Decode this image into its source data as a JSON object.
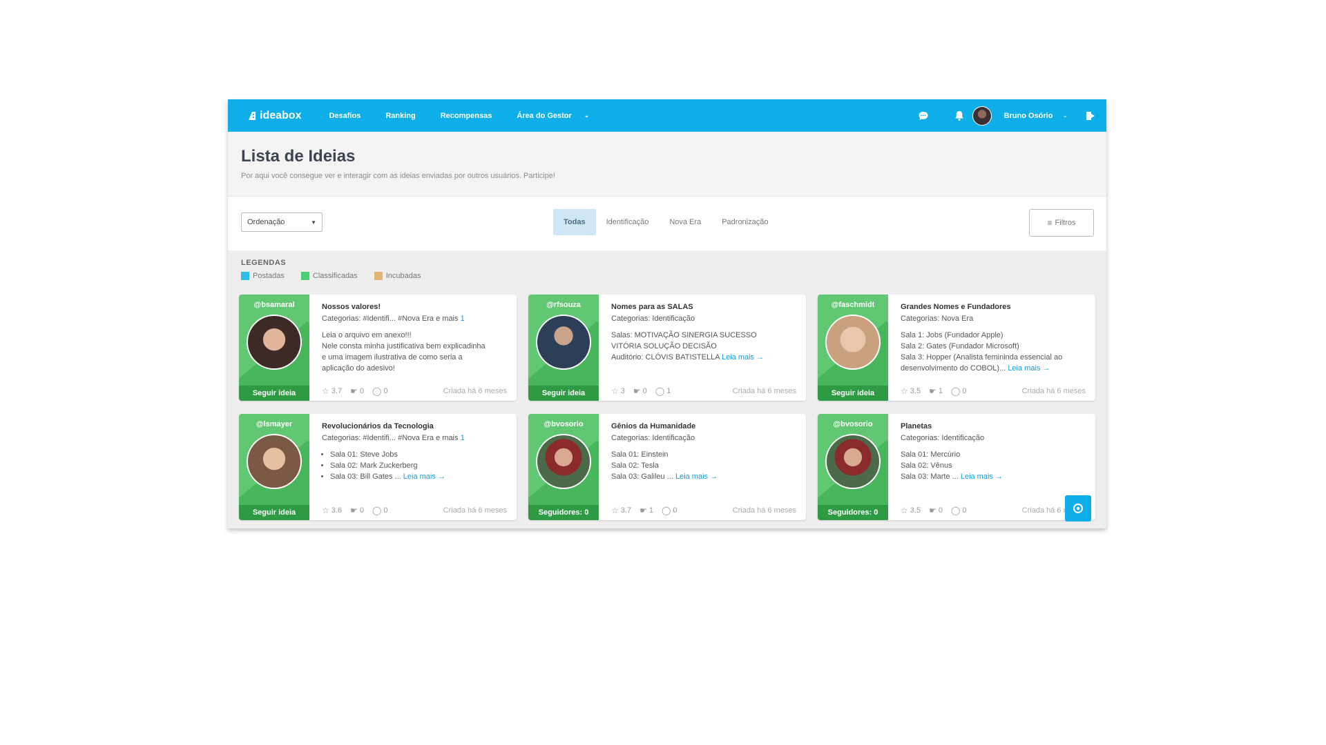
{
  "nav": {
    "logo": "ideabox",
    "links": [
      "Desafios",
      "Ranking",
      "Recompensas"
    ],
    "gestor": "Área do Gestor",
    "user_name": "Bruno Osório",
    "brand_color": "#0eaee9"
  },
  "header": {
    "title": "Lista de Ideias",
    "subtitle": "Por aqui você consegue ver e interagir com as ideias enviadas por outros usuários. Participe!"
  },
  "toolbar": {
    "sort_label": "Ordenação",
    "tabs": [
      "Todas",
      "Identificação",
      "Nova Era",
      "Padronização"
    ],
    "filter_label": "Filtros"
  },
  "legend": {
    "title": "LEGENDAS",
    "items": [
      {
        "label": "Postadas",
        "color": "#2bbde3"
      },
      {
        "label": "Classificadas",
        "color": "#4ccf72"
      },
      {
        "label": "Incubadas",
        "color": "#e2b377"
      }
    ]
  },
  "cards": [
    {
      "user": "@bsamaral",
      "footer": "Seguir ideia",
      "title": "Nossos valores!",
      "cats_label": "Categorias:",
      "cats": "#Identifi... #Nova Era e mais",
      "cats_more": "1",
      "desc": [
        "Leia o arquivo em anexo!!!",
        "Nele consta minha justificativa bem explicadinha",
        "e uma imagem ilustrativa de como seria a",
        "aplicação do adesivo!"
      ],
      "read_more": "",
      "rating": "3.7",
      "likes": "0",
      "comments": "0",
      "date": "Criada há 6 meses",
      "avatar": "#3b2a26"
    },
    {
      "user": "@rfsouza",
      "footer": "Seguir ideia",
      "title": "Nomes para as SALAS",
      "cats_label": "Categorias:",
      "cats": "Identificação",
      "cats_more": "",
      "desc": [
        "Salas: MOTIVAÇÃO  SINERGIA  SUCESSO",
        "VITÓRIA  SOLUÇÃO  DECISÃO",
        "Auditório:  CLÓVIS BATISTELLA"
      ],
      "read_more": "Leia mais →",
      "rating": "3",
      "likes": "0",
      "comments": "1",
      "date": "Criada há 6 meses",
      "avatar": "#2c3e58"
    },
    {
      "user": "@faschmidt",
      "footer": "Seguir ideia",
      "title": "Grandes Nomes e Fundadores",
      "cats_label": "Categorias:",
      "cats": "Nova Era",
      "cats_more": "",
      "desc": [
        "Sala 1: Jobs (Fundador Apple)",
        "Sala 2: Gates (Fundador Microsoft)",
        "Sala 3: Hopper (Analista femininda essencial ao",
        "desenvolvimento do COBOL)..."
      ],
      "read_more": "Leia mais →",
      "rating": "3.5",
      "likes": "1",
      "comments": "0",
      "date": "Criada há 6 meses",
      "avatar": "#d9b9a0"
    },
    {
      "user": "@lsmayer",
      "footer": "Seguir ideia",
      "title": "Revolucionários da Tecnologia",
      "cats_label": "Categorias:",
      "cats": "#Identifi... #Nova Era e mais",
      "cats_more": "1",
      "list": [
        "Sala 01: Steve Jobs",
        "Sala 02: Mark Zuckerberg",
        "Sala 03: Bill Gates  ..."
      ],
      "read_more": "Leia mais →",
      "rating": "3.6",
      "likes": "0",
      "comments": "0",
      "date": "Criada há 6 meses",
      "avatar": "#7a5a45"
    },
    {
      "user": "@bvosorio",
      "footer": "Seguidores: 0",
      "title": "Gênios da Humanidade",
      "cats_label": "Categorias:",
      "cats": "Identificação",
      "cats_more": "",
      "desc": [
        "Sala 01: Einstein",
        "Sala 02: Tesla",
        "Sala 03: Galileu ..."
      ],
      "read_more": "Leia mais →",
      "rating": "3.7",
      "likes": "1",
      "comments": "0",
      "date": "Criada há 6 meses",
      "avatar": "#4a6a4a"
    },
    {
      "user": "@bvosorio",
      "footer": "Seguidores: 0",
      "title": "Planetas",
      "cats_label": "Categorias:",
      "cats": "Identificação",
      "cats_more": "",
      "desc": [
        "Sala 01: Mercúrio",
        "Sala 02: Vênus",
        "Sala 03: Marte ..."
      ],
      "read_more": "Leia mais →",
      "rating": "3.5",
      "likes": "0",
      "comments": "0",
      "date": "Criada há 6 meses",
      "avatar": "#4a6a4a"
    }
  ]
}
